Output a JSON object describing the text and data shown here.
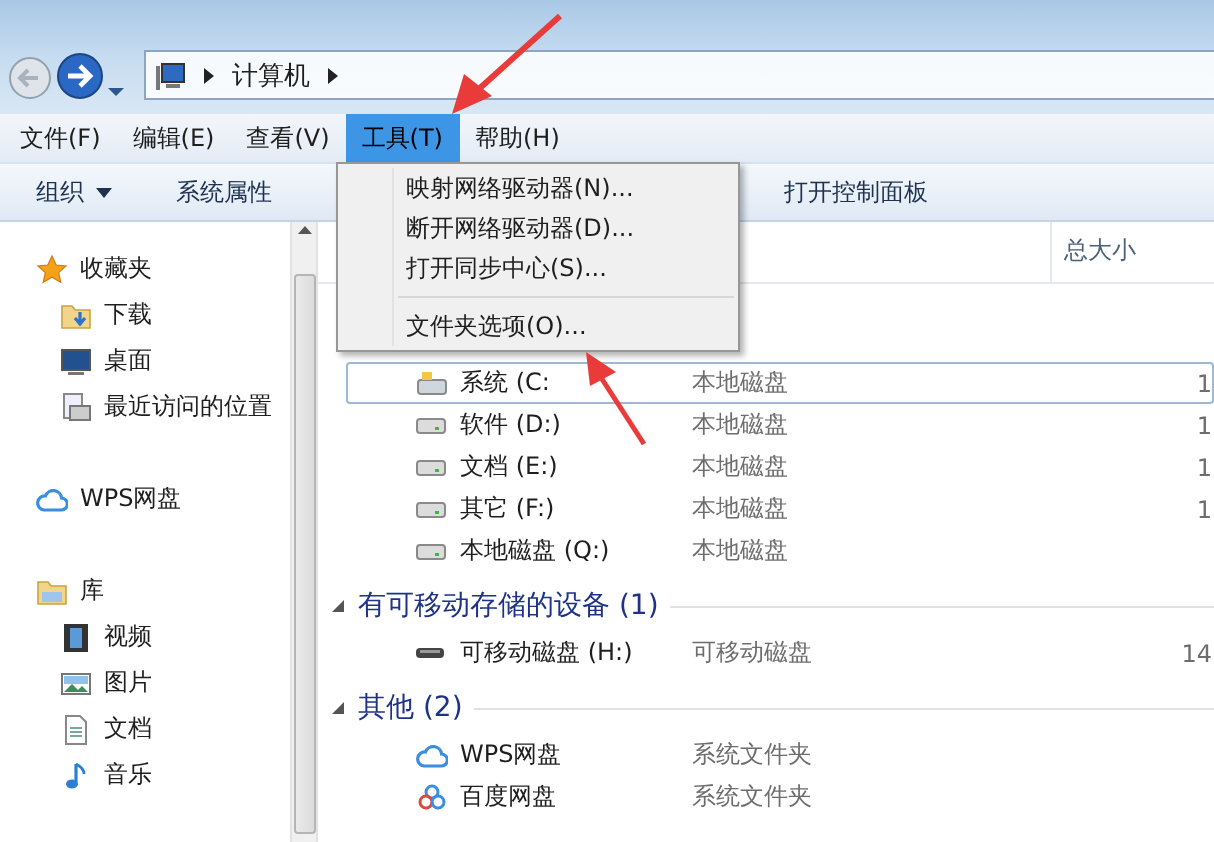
{
  "address_bar": {
    "path": "计算机"
  },
  "menu_bar": [
    {
      "label": "文件(F)",
      "selected": false
    },
    {
      "label": "编辑(E)",
      "selected": false
    },
    {
      "label": "查看(V)",
      "selected": false
    },
    {
      "label": "工具(T)",
      "selected": true
    },
    {
      "label": "帮助(H)",
      "selected": false
    }
  ],
  "dropdown_menu": [
    {
      "kind": "item",
      "label": "映射网络驱动器(N)..."
    },
    {
      "kind": "item",
      "label": "断开网络驱动器(D)..."
    },
    {
      "kind": "item",
      "label": "打开同步中心(S)..."
    },
    {
      "kind": "separator"
    },
    {
      "kind": "item",
      "label": "文件夹选项(O)..."
    }
  ],
  "toolbar": [
    {
      "kind": "dropdown",
      "label": "组织"
    },
    {
      "kind": "button",
      "label": "系统属性"
    },
    {
      "kind": "button",
      "label": "打开控制面板"
    }
  ],
  "sidebar": {
    "groups": [
      {
        "label": "收藏夹",
        "children": [
          {
            "label": "下载"
          },
          {
            "label": "桌面"
          },
          {
            "label": "最近访问的位置"
          }
        ]
      },
      {
        "label": "WPS网盘"
      },
      {
        "label": "库",
        "children": [
          {
            "label": "视频"
          },
          {
            "label": "图片"
          },
          {
            "label": "文档"
          },
          {
            "label": "音乐"
          }
        ]
      }
    ]
  },
  "columns": {
    "column_3": "总大小"
  },
  "sections": [
    {
      "items": [
        {
          "name": "系统 (C:",
          "type": "本地磁盘",
          "size": "1",
          "selected": true
        },
        {
          "name": "软件 (D:)",
          "type": "本地磁盘",
          "size": "1",
          "selected": false
        },
        {
          "name": "文档 (E:)",
          "type": "本地磁盘",
          "size": "1",
          "selected": false
        },
        {
          "name": "其它 (F:)",
          "type": "本地磁盘",
          "size": "1",
          "selected": false
        },
        {
          "name": "本地磁盘 (Q:)",
          "type": "本地磁盘",
          "selected": false
        }
      ]
    },
    {
      "title": "有可移动存储的设备 (1)",
      "expanded": true,
      "items": [
        {
          "name": "可移动磁盘 (H:)",
          "type": "可移动磁盘",
          "size": "14",
          "selected": false
        }
      ]
    },
    {
      "title": "其他 (2)",
      "expanded": true,
      "items": [
        {
          "name": "WPS网盘",
          "type": "系统文件夹",
          "selected": false
        },
        {
          "name": "百度网盘",
          "type": "系统文件夹",
          "selected": false
        }
      ]
    }
  ]
}
